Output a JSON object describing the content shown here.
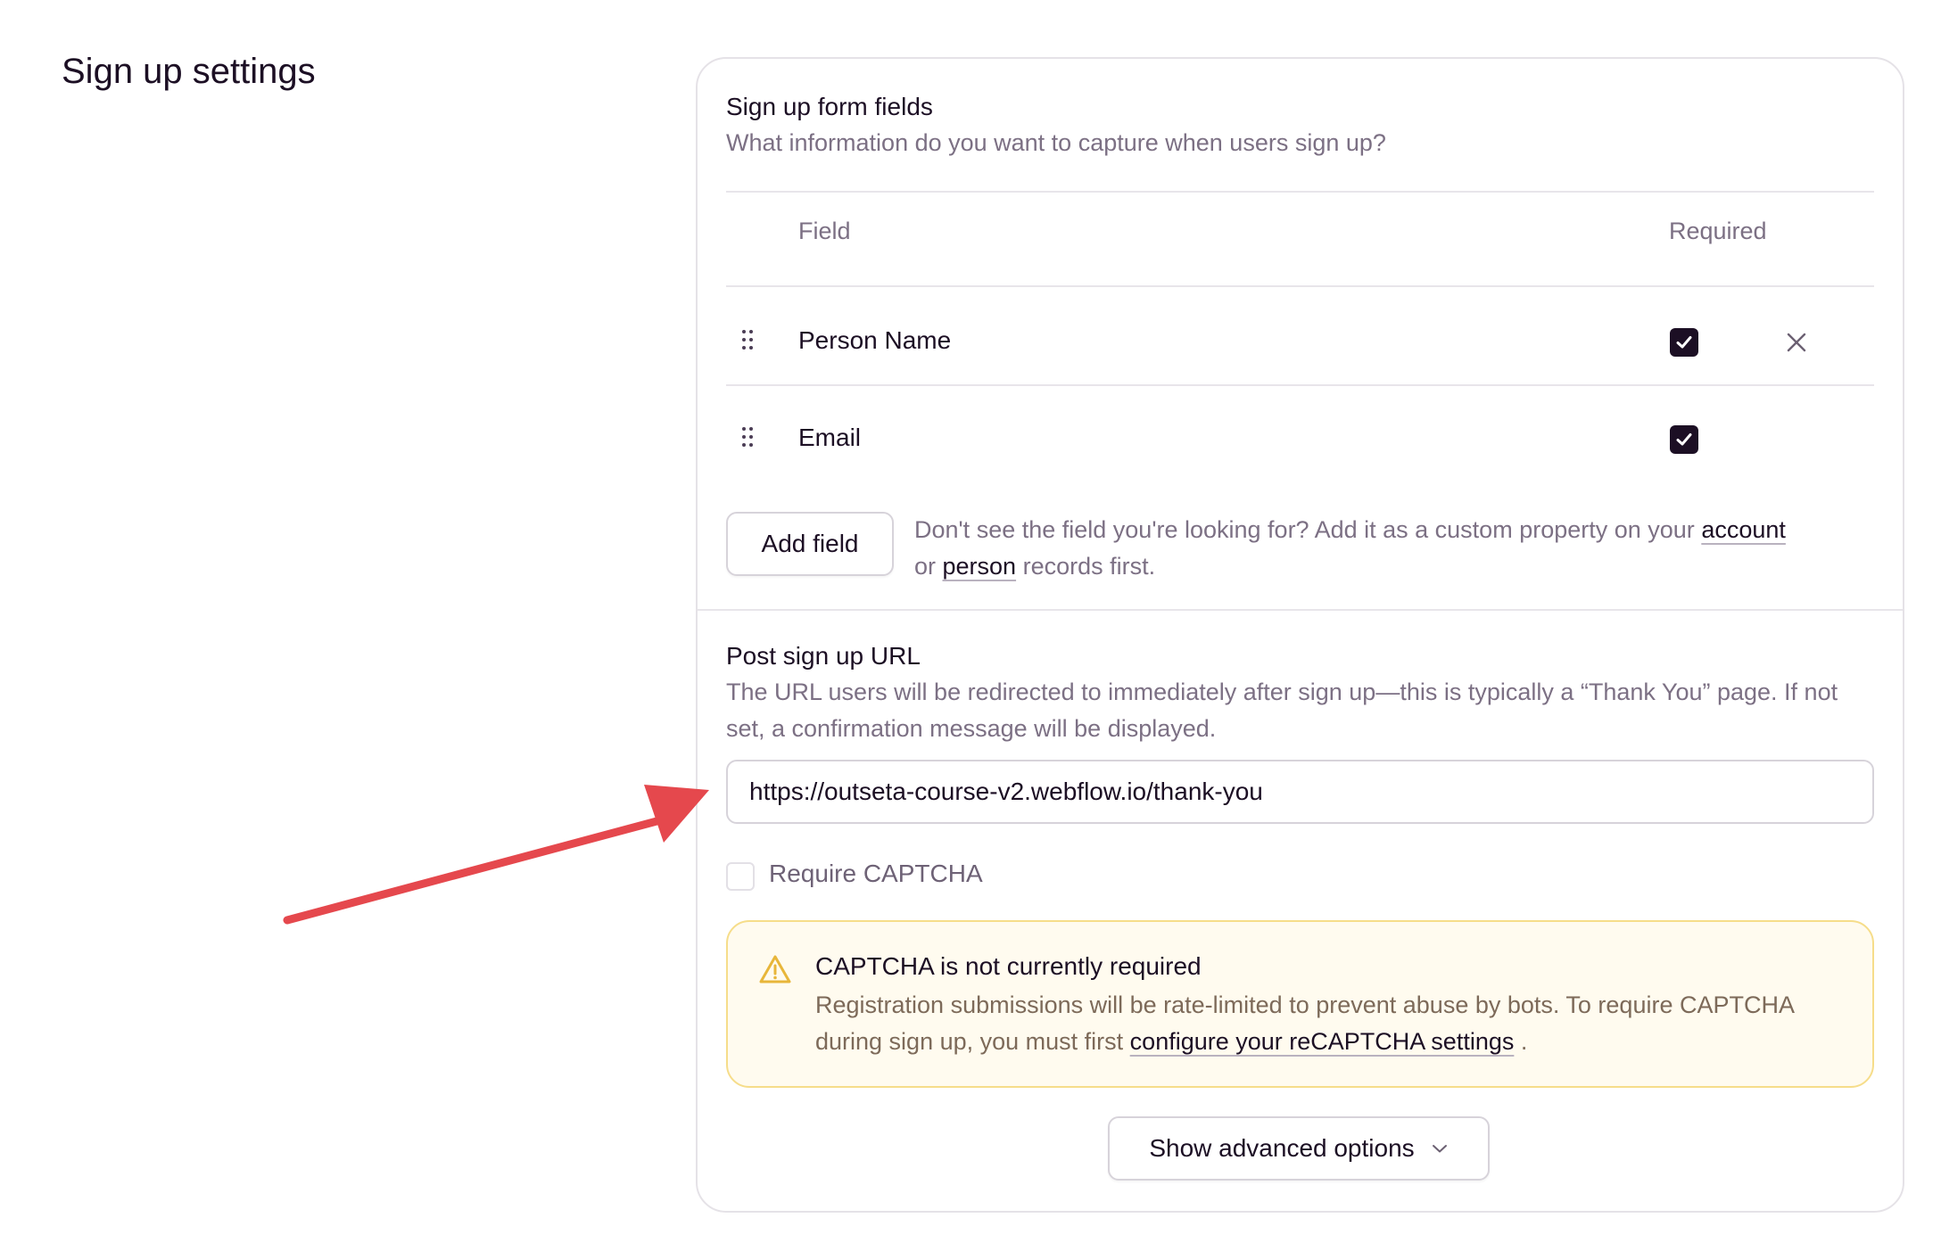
{
  "page": {
    "title": "Sign up settings"
  },
  "signup_fields": {
    "title": "Sign up form fields",
    "description": "What information do you want to capture when users sign up?",
    "columns": {
      "field": "Field",
      "required": "Required"
    },
    "rows": [
      {
        "label": "Person Name",
        "required": true,
        "removable": true
      },
      {
        "label": "Email",
        "required": true,
        "removable": false
      }
    ],
    "add_button": "Add field",
    "help_prefix": "Don't see the field you're looking for? Add it as a custom property on your ",
    "help_link_account": "account",
    "help_or": " or ",
    "help_link_person": "person",
    "help_suffix": " records first."
  },
  "post_signup": {
    "title": "Post sign up URL",
    "description": "The URL users will be redirected to immediately after sign up—this is typically a “Thank You” page. If not set, a confirmation message will be displayed.",
    "url_value": "https://outseta-course-v2.webflow.io/thank-you"
  },
  "captcha": {
    "label": "Require CAPTCHA",
    "checked": false
  },
  "alert": {
    "title": "CAPTCHA is not currently required",
    "body_prefix": "Registration submissions will be rate-limited to prevent abuse by bots. To require CAPTCHA during sign up, you must first ",
    "link": "configure your reCAPTCHA settings",
    "body_suffix": " .",
    "icon": "warning-icon",
    "color": "#e8b63a"
  },
  "advanced_button": "Show advanced options",
  "annotation": {
    "type": "arrow",
    "color": "#e5484d"
  }
}
